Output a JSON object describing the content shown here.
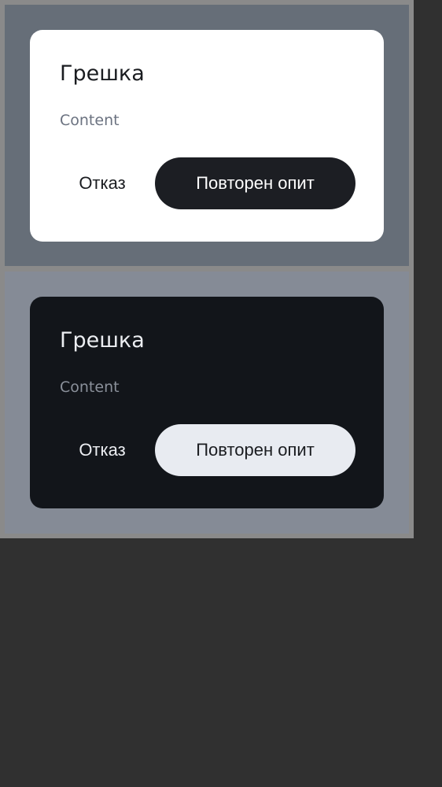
{
  "dialogs": [
    {
      "theme": "light",
      "title": "Грешка",
      "content": "Content",
      "cancel_label": "Отказ",
      "retry_label": "Повторен опит"
    },
    {
      "theme": "dark",
      "title": "Грешка",
      "content": "Content",
      "cancel_label": "Отказ",
      "retry_label": "Повторен опит"
    }
  ]
}
